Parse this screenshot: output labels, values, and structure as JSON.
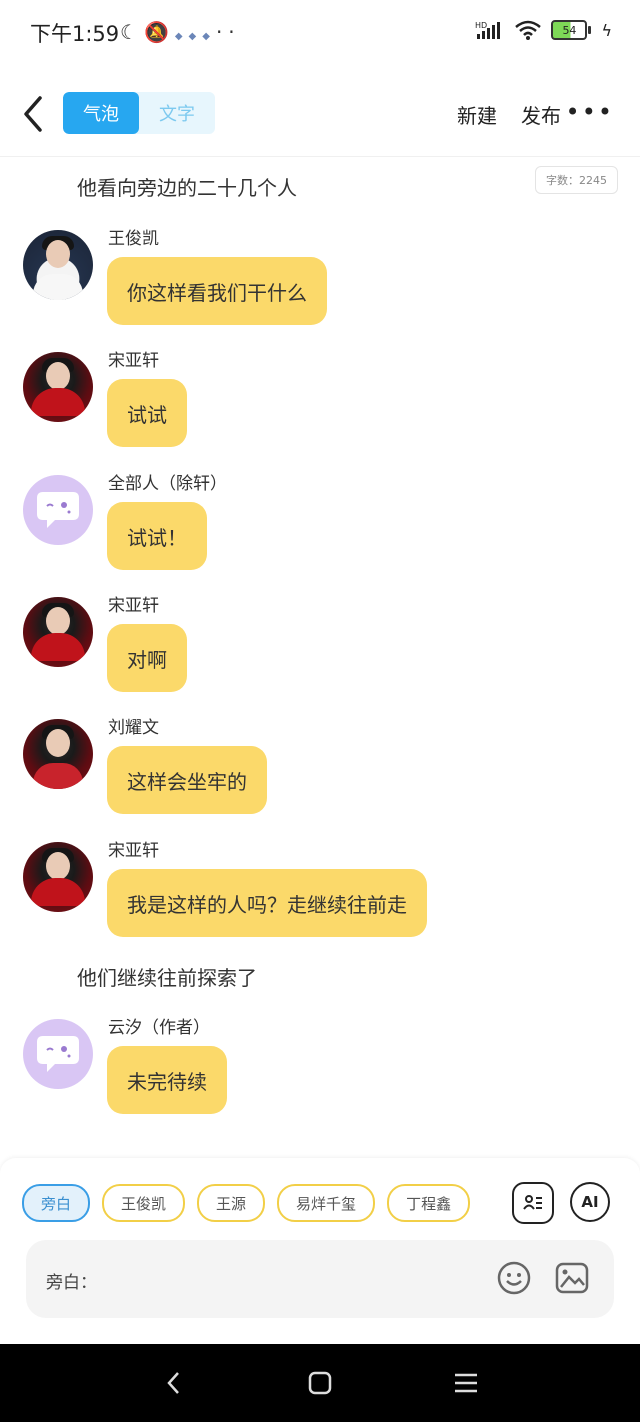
{
  "status_bar": {
    "time": "下午1:59",
    "battery": "54"
  },
  "header": {
    "tabs": [
      {
        "label": "气泡",
        "active": true
      },
      {
        "label": "文字",
        "active": false
      }
    ],
    "new_label": "新建",
    "publish_label": "发布",
    "more_label": "•••"
  },
  "word_count": "字数：2245",
  "narration_1": "他看向旁边的二十几个人",
  "messages": [
    {
      "name": "王俊凯",
      "text": "你这样看我们干什么"
    },
    {
      "name": "宋亚轩",
      "text": "试试"
    },
    {
      "name": "全部人（除轩）",
      "text": "试试！"
    },
    {
      "name": "宋亚轩",
      "text": "对啊"
    },
    {
      "name": "刘耀文",
      "text": "这样会坐牢的"
    },
    {
      "name": "宋亚轩",
      "text": "我是这样的人吗？走继续往前走"
    }
  ],
  "narration_2": "他们继续往前探索了",
  "last_message": {
    "name": "云汐（作者）",
    "text": "未完待续"
  },
  "role_chips": [
    "旁白",
    "王俊凯",
    "王源",
    "易烊千玺",
    "丁程鑫"
  ],
  "ai_label": "AI",
  "input": {
    "label": "旁白："
  },
  "colors": {
    "accent_blue": "#27a7f0",
    "bubble_yellow": "#fbd96a",
    "bot_purple": "#d9c6f4"
  }
}
